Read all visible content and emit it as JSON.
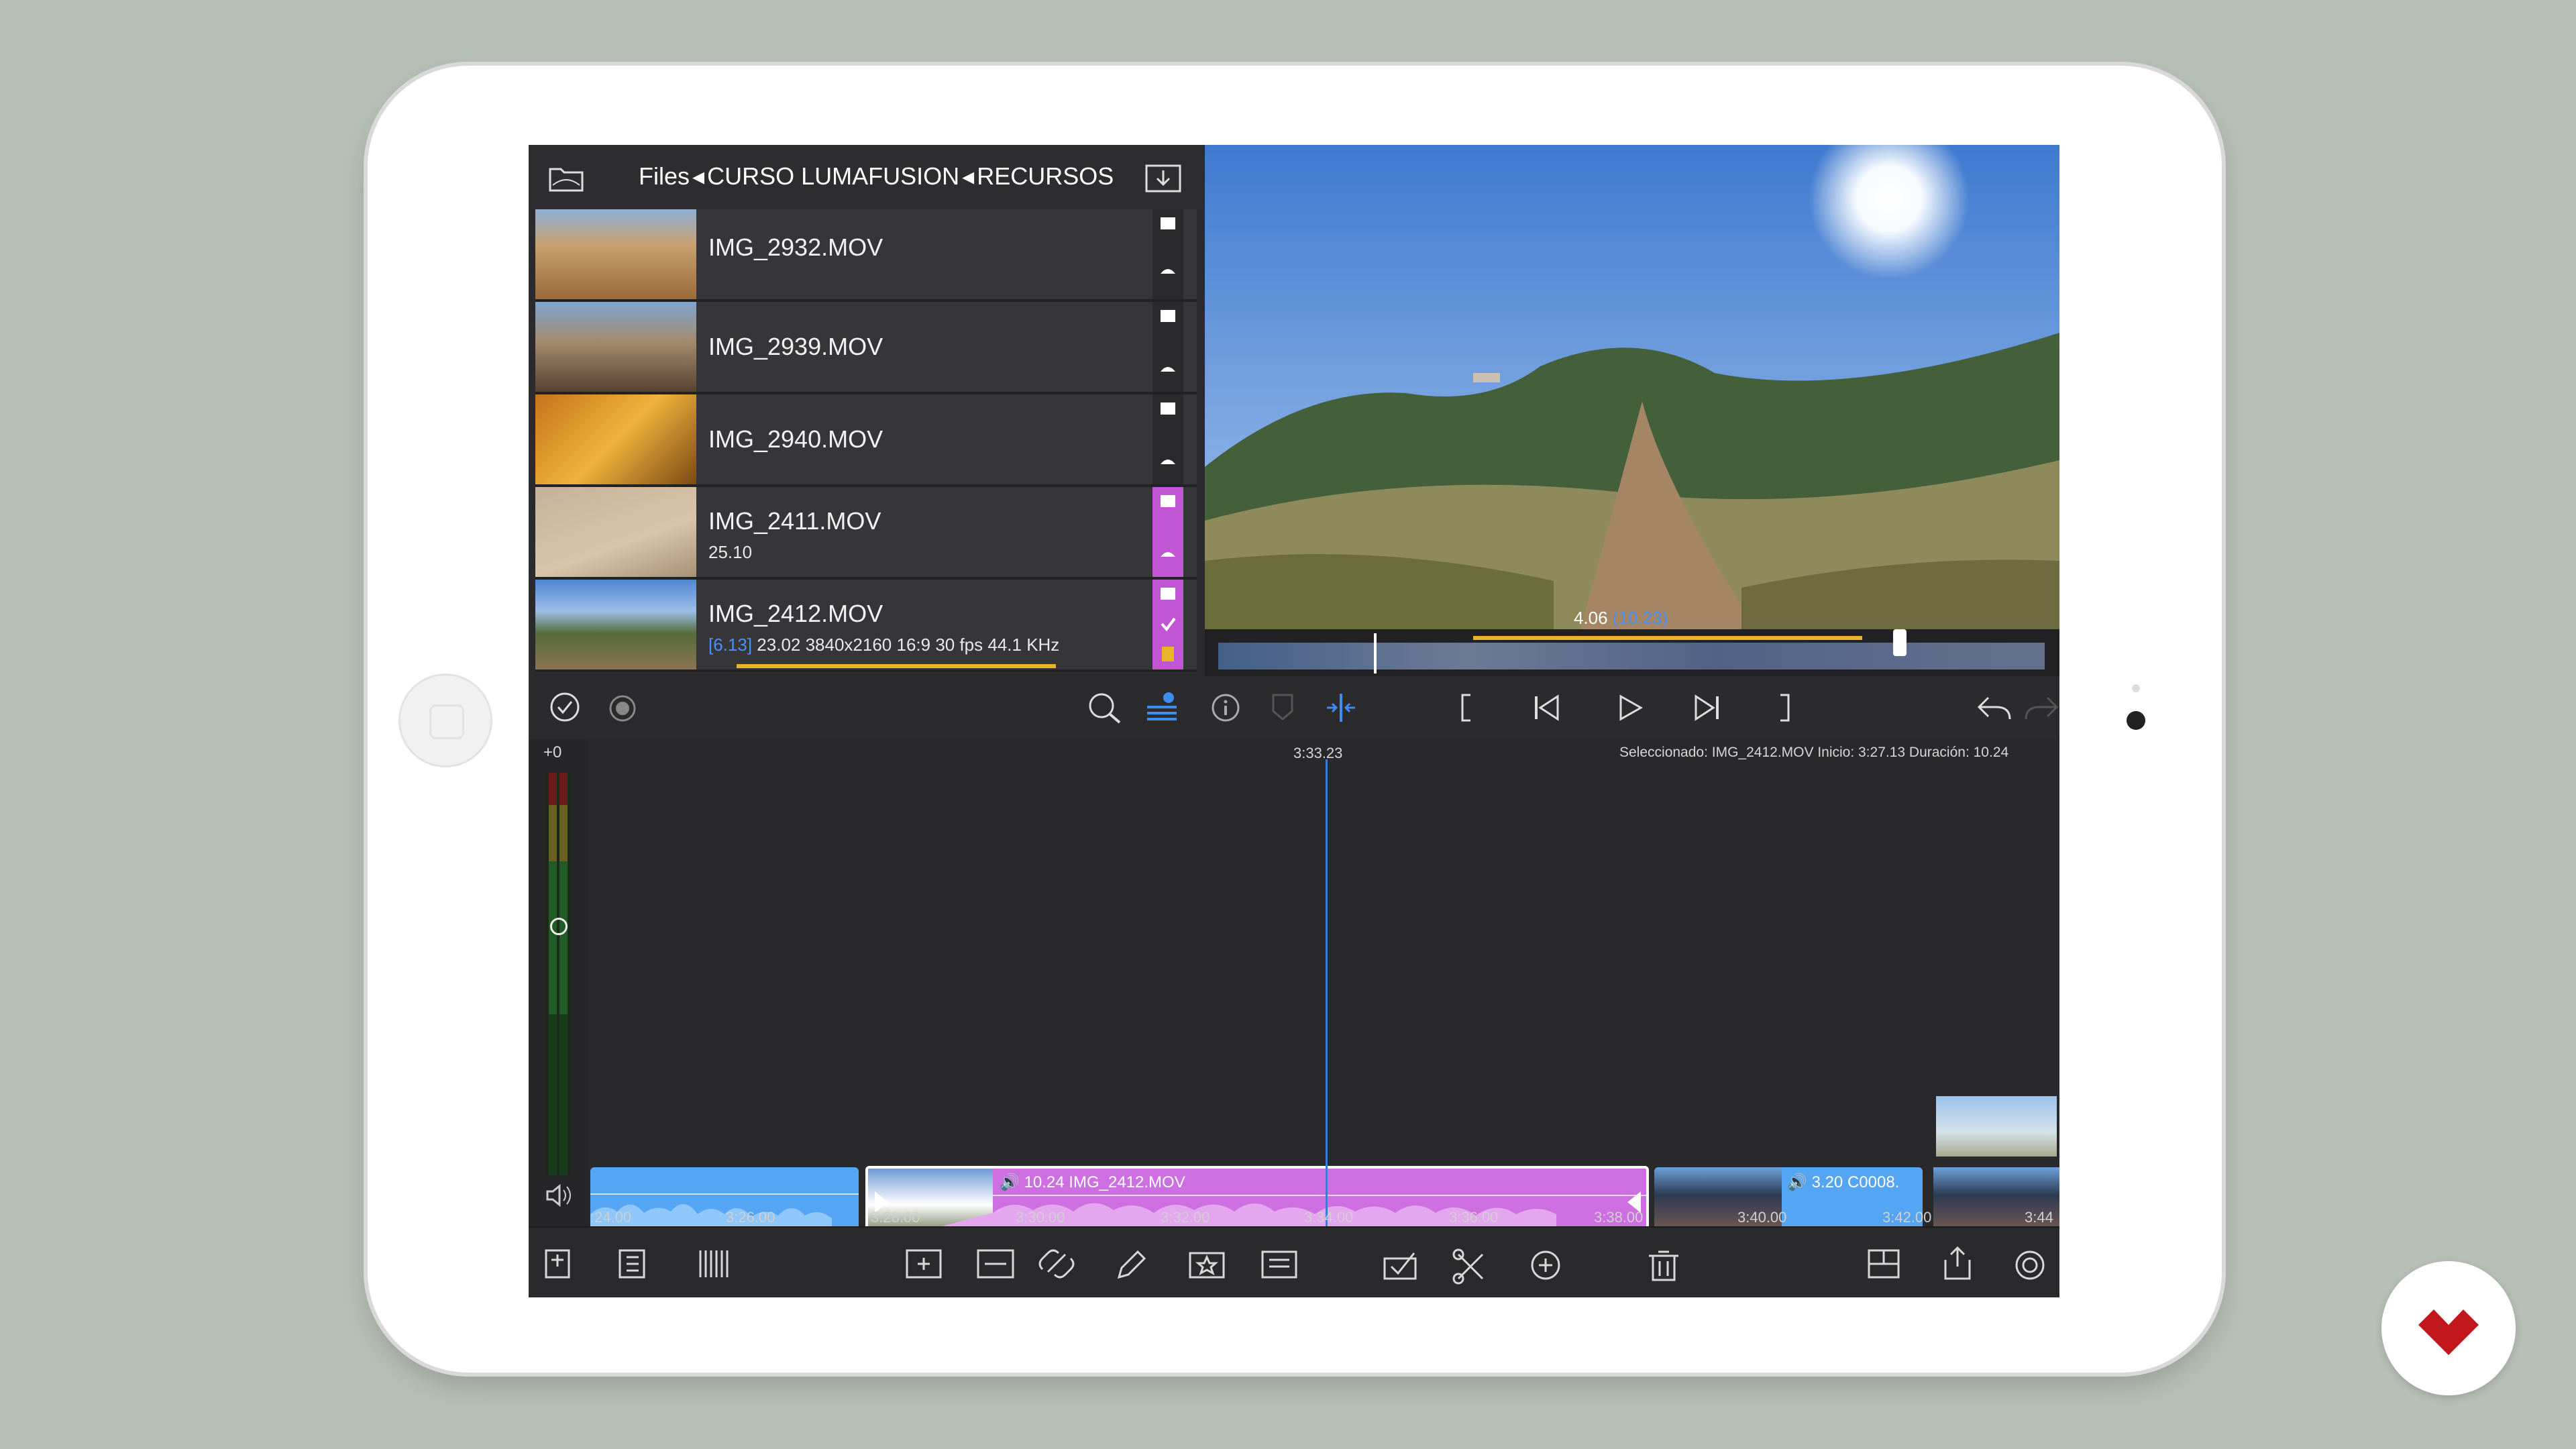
{
  "breadcrumb": {
    "root": "Files",
    "sep1": "◂",
    "folder": "CURSO LUMAFUSION",
    "sep2": "◂",
    "sub": "RECURSOS"
  },
  "files": [
    {
      "name": "IMG_2932.MOV",
      "sub": ""
    },
    {
      "name": "IMG_2939.MOV",
      "sub": ""
    },
    {
      "name": "IMG_2940.MOV",
      "sub": ""
    },
    {
      "name": "IMG_2411.MOV",
      "sub": "25.10"
    },
    {
      "name": "IMG_2412.MOV",
      "sub_blue": "[6.13]",
      "sub": "23.02  3840x2160  16:9  30 fps  44.1 KHz"
    }
  ],
  "viewer": {
    "time": "4.06",
    "time_paren": "(10.23)"
  },
  "timeline": {
    "playhead": "3:33.23",
    "selection_info": "Seleccionado: IMG_2412.MOV Inicio: 3:27.13 Duración: 10.24",
    "level_label": "+0",
    "ticks": [
      ":24.00",
      "3:26.00",
      "3:28.00",
      "3:30.00",
      "3:32.00",
      "3:34.00",
      "3:36.00",
      "3:38.00",
      "3:40.00",
      "3:42.00",
      "3:44"
    ],
    "clip_main": {
      "duration": "10.24",
      "name": "IMG_2412.MOV"
    },
    "clip_next": {
      "duration": "3.20",
      "name": "C0008."
    }
  },
  "icons": {
    "folder": "folder-icon",
    "import": "import-icon",
    "check": "check-circle-icon",
    "record": "record-icon",
    "search": "search-icon",
    "sort": "sort-icon",
    "info": "info-icon",
    "marker": "marker-icon",
    "split": "split-icon",
    "in": "mark-in-icon",
    "prev": "previous-icon",
    "play": "play-icon",
    "next": "next-icon",
    "out": "mark-out-icon",
    "undo": "undo-icon",
    "redo": "redo-icon"
  },
  "colors": {
    "accent": "#c056d3",
    "blue_clip": "#54a5f3",
    "playhead": "#3d7bd9",
    "logo": "#c3171e"
  }
}
